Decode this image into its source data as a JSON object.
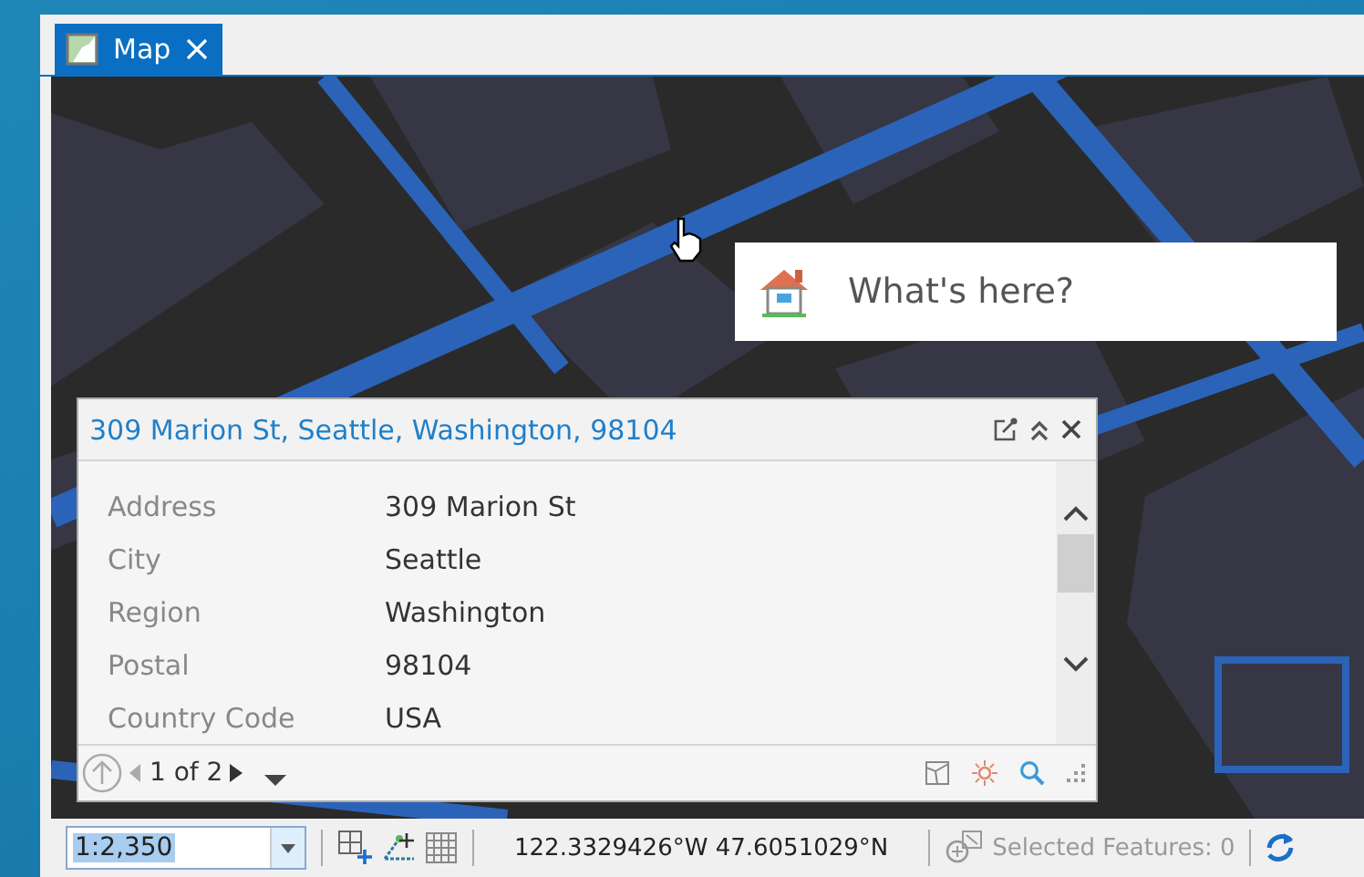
{
  "tab": {
    "label": "Map",
    "selected": true
  },
  "whats_here": {
    "label": "What's here?"
  },
  "popup": {
    "title": "309 Marion St, Seattle, Washington, 98104",
    "fields": [
      {
        "label": "Address",
        "value": "309 Marion St"
      },
      {
        "label": "City",
        "value": "Seattle"
      },
      {
        "label": "Region",
        "value": "Washington"
      },
      {
        "label": "Postal",
        "value": "98104"
      },
      {
        "label": "Country Code",
        "value": "USA"
      }
    ],
    "pager": "1 of 2"
  },
  "status_bar": {
    "scale": "1:2,350",
    "scale_selected": true,
    "coordinates": "122.3329426°W 47.6051029°N",
    "selected_features": "Selected Features: 0"
  }
}
